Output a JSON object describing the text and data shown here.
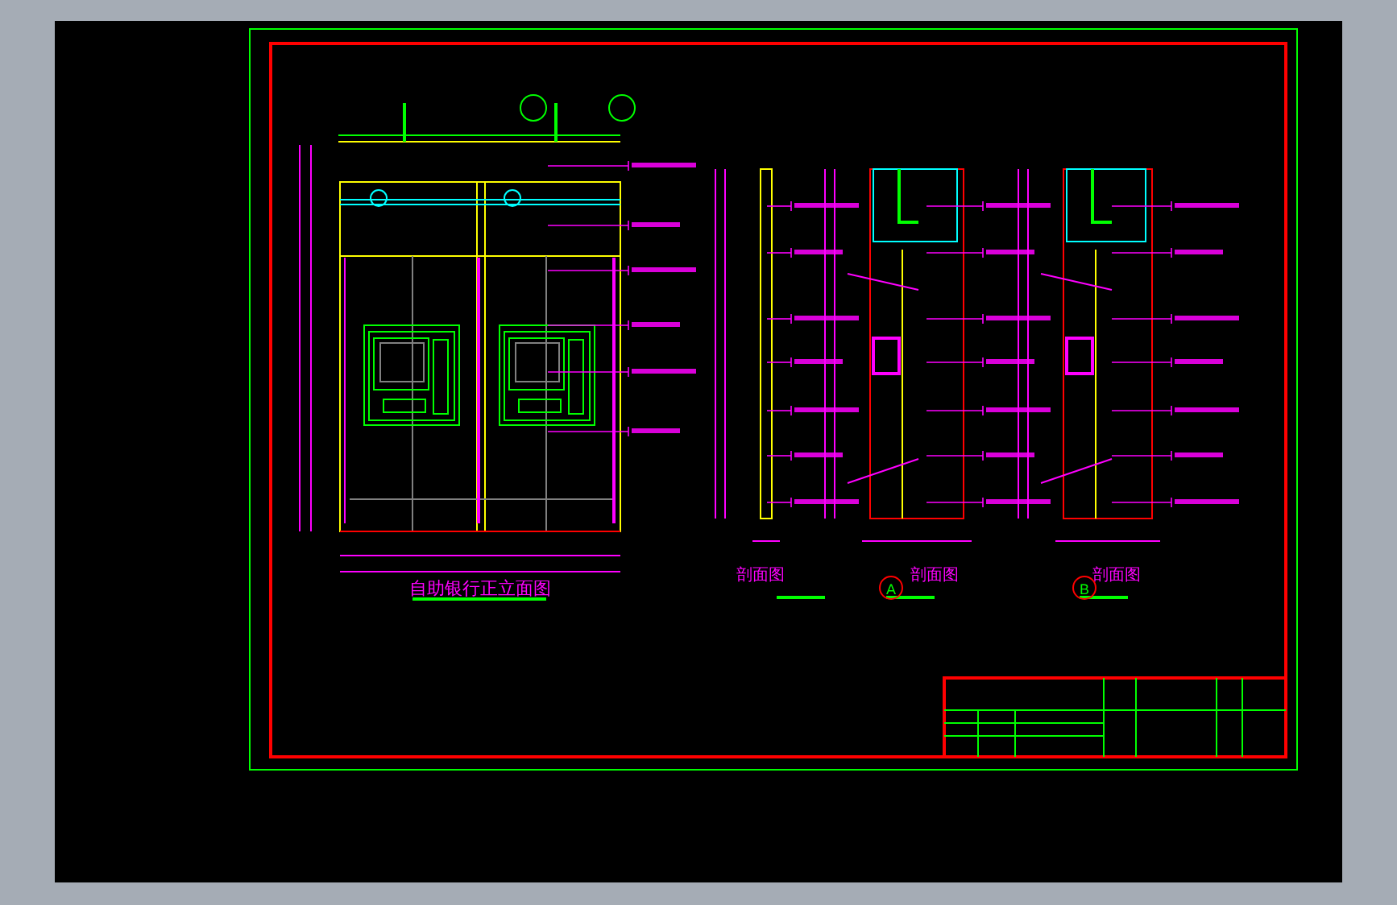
{
  "views": [
    {
      "kind": "elevation",
      "title": "自助银行正立面图"
    },
    {
      "kind": "section",
      "title": "剖面图"
    },
    {
      "kind": "section",
      "title": "剖面图",
      "marker": "A"
    },
    {
      "kind": "section",
      "title": "剖面图",
      "marker": "B"
    }
  ]
}
